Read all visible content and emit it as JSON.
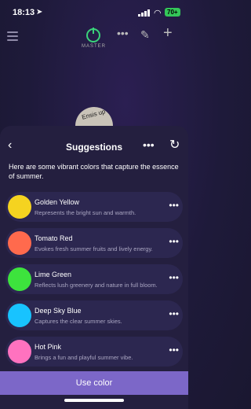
{
  "status": {
    "time": "18:13",
    "battery": "70+"
  },
  "topbar": {
    "device_label": "MASTER"
  },
  "dial": {
    "label": "Ensis up"
  },
  "sheet": {
    "title": "Suggestions",
    "intro": "Here are some vibrant colors that capture the essence of summer.",
    "items": [
      {
        "name": "Golden Yellow",
        "description": "Represents the bright sun and warmth.",
        "color": "#f5d320"
      },
      {
        "name": "Tomato Red",
        "description": "Evokes fresh summer fruits and lively energy.",
        "color": "#ff6a4d"
      },
      {
        "name": "Lime Green",
        "description": "Reflects lush greenery and nature in full bloom.",
        "color": "#3de33d"
      },
      {
        "name": "Deep Sky Blue",
        "description": "Captures the clear summer skies.",
        "color": "#18c3ff"
      },
      {
        "name": "Hot Pink",
        "description": "Brings a fun and playful summer vibe.",
        "color": "#ff72bf"
      }
    ],
    "use_button": "Use color"
  }
}
